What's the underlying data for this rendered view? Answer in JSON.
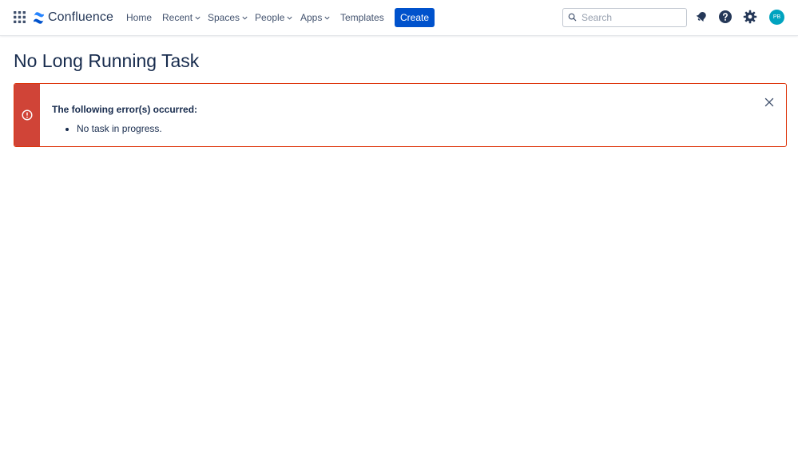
{
  "header": {
    "app_name": "Confluence",
    "nav": {
      "home": "Home",
      "recent": "Recent",
      "spaces": "Spaces",
      "people": "People",
      "apps": "Apps",
      "templates": "Templates"
    },
    "create_label": "Create",
    "search_placeholder": "Search",
    "avatar_initials": "PB",
    "icons": [
      "app-switcher-icon",
      "confluence-logo-icon",
      "notifications-icon",
      "help-icon",
      "settings-icon"
    ]
  },
  "page": {
    "title": "No Long Running Task"
  },
  "error": {
    "heading": "The following error(s) occurred:",
    "items": [
      "No task in progress."
    ]
  },
  "colors": {
    "primary": "#0052cc",
    "error_strip": "#d04437",
    "error_border": "#de350b",
    "avatar": "#00a3bf"
  }
}
